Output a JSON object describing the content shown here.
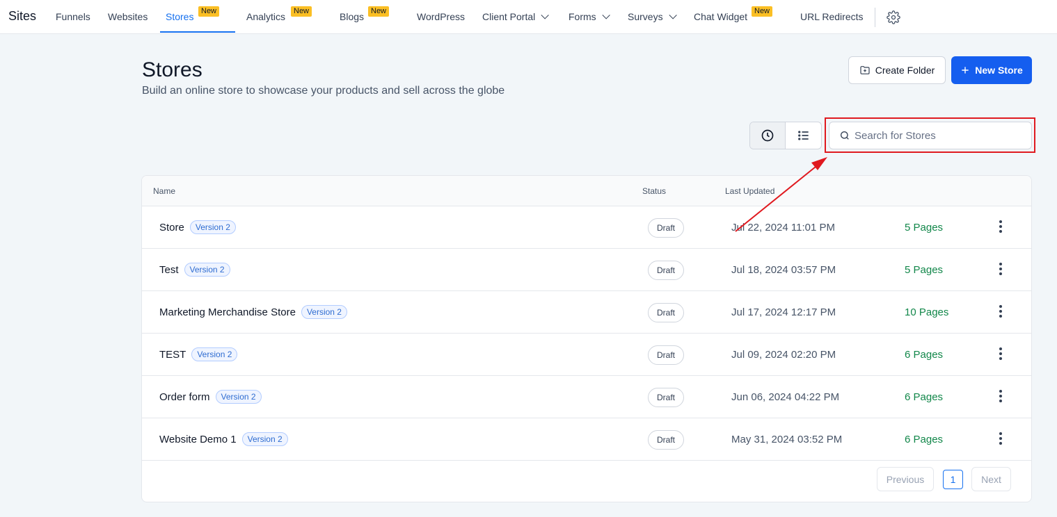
{
  "nav": {
    "brand": "Sites",
    "items": [
      {
        "label": "Funnels"
      },
      {
        "label": "Websites"
      },
      {
        "label": "Stores",
        "badge": "New"
      },
      {
        "label": "Analytics",
        "badge": "New"
      },
      {
        "label": "Blogs",
        "badge": "New"
      },
      {
        "label": "WordPress"
      },
      {
        "label": "Client Portal"
      },
      {
        "label": "Forms"
      },
      {
        "label": "Surveys"
      },
      {
        "label": "Chat Widget",
        "badge": "New"
      },
      {
        "label": "URL Redirects"
      }
    ],
    "settings_icon": "gear-icon"
  },
  "header": {
    "title": "Stores",
    "subtitle": "Build an online store to showcase your products and sell across the globe",
    "create_folder_label": "Create Folder",
    "new_store_label": "New Store"
  },
  "toolbar": {
    "search_placeholder": "Search for Stores",
    "search_value": ""
  },
  "table": {
    "columns": [
      "Name",
      "Status",
      "Last Updated"
    ],
    "rows": [
      {
        "name": "Store",
        "version": "Version 2",
        "status": "Draft",
        "updated": "Jul 22, 2024 11:01 PM",
        "pages": "5 Pages"
      },
      {
        "name": "Test",
        "version": "Version 2",
        "status": "Draft",
        "updated": "Jul 18, 2024 03:57 PM",
        "pages": "5 Pages"
      },
      {
        "name": "Marketing Merchandise Store",
        "version": "Version 2",
        "status": "Draft",
        "updated": "Jul 17, 2024 12:17 PM",
        "pages": "10 Pages"
      },
      {
        "name": "TEST",
        "version": "Version 2",
        "status": "Draft",
        "updated": "Jul 09, 2024 02:20 PM",
        "pages": "6 Pages"
      },
      {
        "name": "Order form",
        "version": "Version 2",
        "status": "Draft",
        "updated": "Jun 06, 2024 04:22 PM",
        "pages": "6 Pages"
      },
      {
        "name": "Website Demo 1",
        "version": "Version 2",
        "status": "Draft",
        "updated": "May 31, 2024 03:52 PM",
        "pages": "6 Pages"
      }
    ]
  },
  "pagination": {
    "previous_label": "Previous",
    "current_page": "1",
    "next_label": "Next"
  },
  "colors": {
    "accent": "#155eef",
    "pages_green": "#12874a",
    "badge_yellow": "#fbbf24",
    "annotation_red": "#e0191f"
  }
}
